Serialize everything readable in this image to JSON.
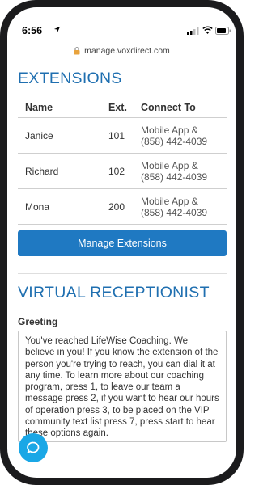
{
  "status_bar": {
    "time": "6:56"
  },
  "address_bar": {
    "url": "manage.voxdirect.com"
  },
  "extensions": {
    "title": "EXTENSIONS",
    "columns": [
      "Name",
      "Ext.",
      "Connect To"
    ],
    "rows": [
      {
        "name": "Janice",
        "ext": "101",
        "connect_line1": "Mobile App &",
        "connect_line2": "(858) 442-4039"
      },
      {
        "name": "Richard",
        "ext": "102",
        "connect_line1": "Mobile App &",
        "connect_line2": "(858) 442-4039"
      },
      {
        "name": "Mona",
        "ext": "200",
        "connect_line1": "Mobile App &",
        "connect_line2": "(858) 442-4039"
      }
    ],
    "manage_button_label": "Manage Extensions"
  },
  "receptionist": {
    "title": "VIRTUAL RECEPTIONIST",
    "greeting_label": "Greeting",
    "greeting_text": "You've reached LifeWise Coaching. We believe in you! If you know the extension of the person you're trying to reach, you can dial it at any time. To learn more about our coaching program, press 1, to leave our team a message press 2, if you want to hear our hours of operation press 3, to be placed on the VIP community text list press 7, press start to hear these options again."
  },
  "colors": {
    "accent": "#1f6fb0",
    "button": "#1f79c2",
    "chat": "#1aa7e6"
  }
}
